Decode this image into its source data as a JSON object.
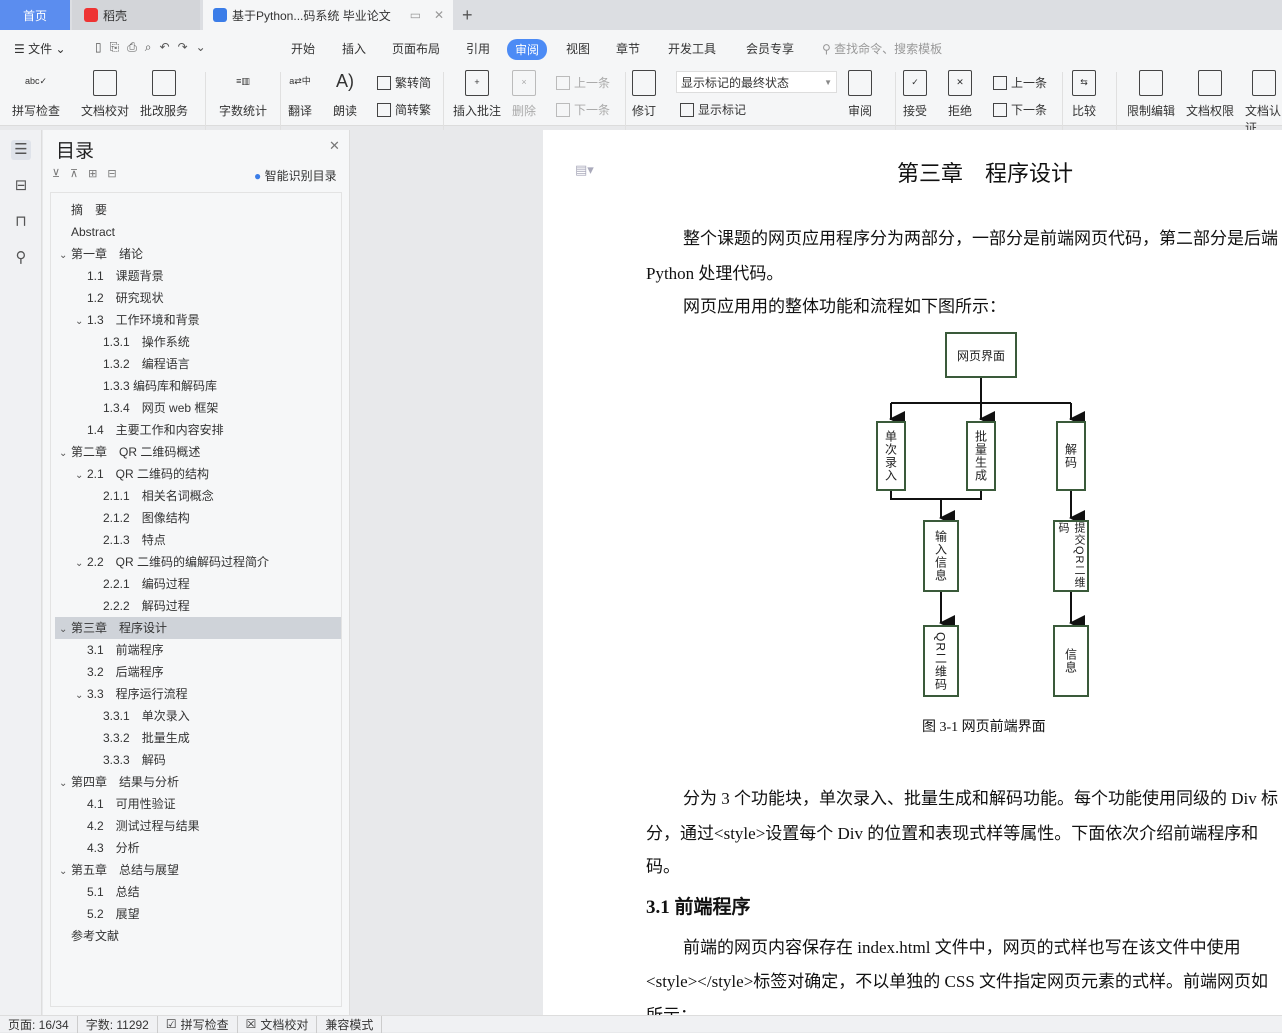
{
  "tabs": {
    "home": "首页",
    "daoke": "稻壳",
    "doc": "基于Python...码系统 毕业论文",
    "new": "+"
  },
  "toolbar": {
    "file": "文件",
    "menus": [
      "开始",
      "插入",
      "页面布局",
      "引用",
      "审阅",
      "视图",
      "章节",
      "开发工具",
      "会员专享"
    ],
    "active_menu": "审阅",
    "search_placeholder": "查找命令、搜索模板"
  },
  "ribbon": {
    "spell": "拼写检查",
    "proof": "文档校对",
    "correct": "批改服务",
    "wordcount": "字数统计",
    "translate": "翻译",
    "read": "朗读",
    "t2s": "繁转简",
    "s2t": "简转繁",
    "insert_comment": "插入批注",
    "delete": "删除",
    "prev": "上一条",
    "next": "下一条",
    "revise": "修订",
    "markup_state": "显示标记的最终状态",
    "show_markup": "显示标记",
    "review": "审阅",
    "accept": "接受",
    "reject": "拒绝",
    "prev2": "上一条",
    "next2": "下一条",
    "compare": "比较",
    "restrict": "限制编辑",
    "permission": "文档权限",
    "cert": "文档认证"
  },
  "toc": {
    "title": "目录",
    "smart": "智能识别目录",
    "items": [
      {
        "label": "摘　要",
        "level": 0,
        "chev": ""
      },
      {
        "label": "Abstract",
        "level": 0,
        "chev": ""
      },
      {
        "label": "第一章　绪论",
        "level": 0,
        "chev": "v"
      },
      {
        "label": "1.1　课题背景",
        "level": 1,
        "chev": ""
      },
      {
        "label": "1.2　研究现状",
        "level": 1,
        "chev": ""
      },
      {
        "label": "1.3　工作环境和背景",
        "level": 1,
        "chev": "v"
      },
      {
        "label": "1.3.1　操作系统",
        "level": 2,
        "chev": ""
      },
      {
        "label": "1.3.2　编程语言",
        "level": 2,
        "chev": ""
      },
      {
        "label": "1.3.3 编码库和解码库",
        "level": 2,
        "chev": ""
      },
      {
        "label": "1.3.4　网页 web 框架",
        "level": 2,
        "chev": ""
      },
      {
        "label": "1.4　主要工作和内容安排",
        "level": 1,
        "chev": ""
      },
      {
        "label": "第二章　QR 二维码概述",
        "level": 0,
        "chev": "v"
      },
      {
        "label": "2.1　QR 二维码的结构",
        "level": 1,
        "chev": "v"
      },
      {
        "label": "2.1.1　相关名词概念",
        "level": 2,
        "chev": ""
      },
      {
        "label": "2.1.2　图像结构",
        "level": 2,
        "chev": ""
      },
      {
        "label": "2.1.3　特点",
        "level": 2,
        "chev": ""
      },
      {
        "label": "2.2　QR 二维码的编解码过程简介",
        "level": 1,
        "chev": "v"
      },
      {
        "label": "2.2.1　编码过程",
        "level": 2,
        "chev": ""
      },
      {
        "label": "2.2.2　解码过程",
        "level": 2,
        "chev": ""
      },
      {
        "label": "第三章　程序设计",
        "level": 0,
        "chev": "v",
        "selected": true
      },
      {
        "label": "3.1　前端程序",
        "level": 1,
        "chev": ""
      },
      {
        "label": "3.2　后端程序",
        "level": 1,
        "chev": ""
      },
      {
        "label": "3.3　程序运行流程",
        "level": 1,
        "chev": "v"
      },
      {
        "label": "3.3.1　单次录入",
        "level": 2,
        "chev": ""
      },
      {
        "label": "3.3.2　批量生成",
        "level": 2,
        "chev": ""
      },
      {
        "label": "3.3.3　解码",
        "level": 2,
        "chev": ""
      },
      {
        "label": "第四章　结果与分析",
        "level": 0,
        "chev": "v"
      },
      {
        "label": "4.1　可用性验证",
        "level": 1,
        "chev": ""
      },
      {
        "label": "4.2　测试过程与结果",
        "level": 1,
        "chev": ""
      },
      {
        "label": "4.3　分析",
        "level": 1,
        "chev": ""
      },
      {
        "label": "第五章　总结与展望",
        "level": 0,
        "chev": "v"
      },
      {
        "label": "5.1　总结",
        "level": 1,
        "chev": ""
      },
      {
        "label": "5.2　展望",
        "level": 1,
        "chev": ""
      },
      {
        "label": "参考文献",
        "level": 0,
        "chev": ""
      }
    ]
  },
  "doc": {
    "heading": "第三章　程序设计",
    "p1a": "整个课题的网页应用程序分为两部分，一部分是前端网页代码，第二部分是后端",
    "p1b": "Python 处理代码。",
    "p2": "网页应用用的整体功能和流程如下图所示：",
    "diagram": {
      "root": "网页界面",
      "single": "单次录入",
      "batch": "批量生成",
      "decode": "解码",
      "input": "输入信息",
      "qr": "QR二维码",
      "submit": "提交QR二维码",
      "info": "信息"
    },
    "caption": "图 3-1 网页前端界面",
    "p3a": "分为 3 个功能块，单次录入、批量生成和解码功能。每个功能使用同级的 Div 标",
    "p3b": "分，通过<style>设置每个 Div 的位置和表现式样等属性。下面依次介绍前端程序和",
    "p3c": "码。",
    "h31": "3.1  前端程序",
    "p4a": "前端的网页内容保存在 index.html 文件中，网页的式样也写在该文件中使用",
    "p4b": "<style></style>标签对确定，不以单独的 CSS 文件指定网页元素的式样。前端网页如",
    "p4c": "所示："
  },
  "status": {
    "page": "页面: 16/34",
    "words": "字数: 11292",
    "spell": "拼写检查",
    "proof": "文档校对",
    "compat": "兼容模式"
  },
  "colors": {
    "accent": "#4c8bf5",
    "home_tab": "#5b8def",
    "box_border": "#3a5a3a"
  }
}
